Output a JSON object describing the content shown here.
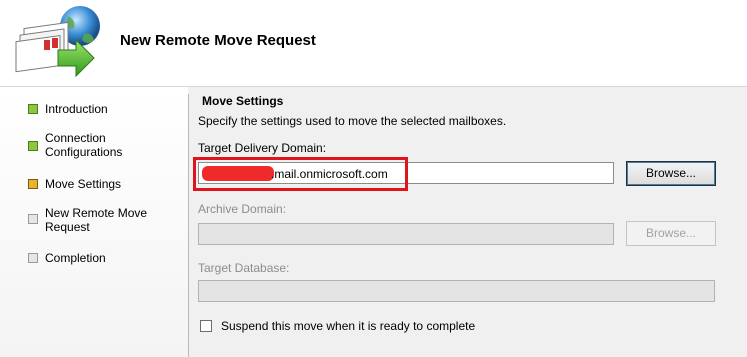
{
  "header": {
    "title": "New Remote Move Request"
  },
  "steps": [
    {
      "label": "Introduction",
      "status": "done"
    },
    {
      "label": "Connection Configurations",
      "status": "done"
    },
    {
      "label": "Move Settings",
      "status": "current"
    },
    {
      "label": "New Remote Move Request",
      "status": "pending"
    },
    {
      "label": "Completion",
      "status": "pending"
    }
  ],
  "main": {
    "section_title": "Move Settings",
    "section_description": "Specify the settings used to move the selected mailboxes.",
    "target_delivery_domain": {
      "label": "Target Delivery Domain:",
      "value_suffix": ".mail.onmicrosoft.com",
      "browse_label": "Browse..."
    },
    "archive_domain": {
      "label": "Archive Domain:",
      "value": "",
      "browse_label": "Browse..."
    },
    "target_database": {
      "label": "Target Database:",
      "value": ""
    },
    "suspend_checkbox": {
      "label": "Suspend this move when it is ready to complete",
      "checked": false
    }
  },
  "colors": {
    "step_done": "#8ec63f",
    "step_current": "#e8b52a",
    "highlight": "#e0141c",
    "redaction": "#ee2a2a"
  }
}
